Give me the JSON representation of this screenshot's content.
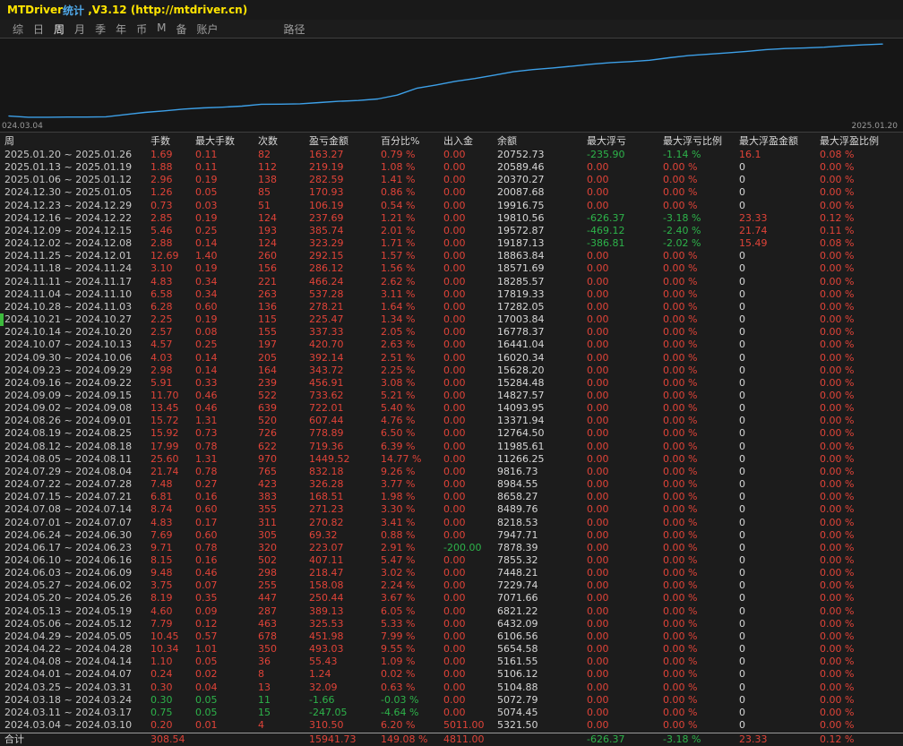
{
  "title_bar": {
    "app_name": "MTDriver",
    "app_suffix": "统计",
    "version": " ,V3.12 (http://mtdriver.cn)"
  },
  "menu": {
    "items": [
      "综",
      "日",
      "周",
      "月",
      "季",
      "年",
      "币",
      "M",
      "备",
      "账户"
    ],
    "selected": "周",
    "path_label": "路径"
  },
  "colors": {
    "accent_red": "#e04338",
    "accent_green": "#2db34a",
    "chart_line": "#3da0e8",
    "title_yellow": "#ffe400"
  },
  "chart_data": {
    "type": "line",
    "title": "",
    "xlabel": "",
    "ylabel": "余额",
    "x_start_label": "024.03.04",
    "x_end_label": "2025.01.20",
    "ylim": [
      5000,
      21000
    ],
    "legend": false,
    "grid": false,
    "x": [
      "2024.03.04",
      "2024.03.11",
      "2024.03.18",
      "2024.03.25",
      "2024.04.01",
      "2024.04.08",
      "2024.04.22",
      "2024.04.29",
      "2024.05.06",
      "2024.05.13",
      "2024.05.20",
      "2024.05.27",
      "2024.06.03",
      "2024.06.10",
      "2024.06.17",
      "2024.06.24",
      "2024.07.01",
      "2024.07.08",
      "2024.07.15",
      "2024.07.22",
      "2024.07.29",
      "2024.08.05",
      "2024.08.12",
      "2024.08.19",
      "2024.08.26",
      "2024.09.02",
      "2024.09.09",
      "2024.09.16",
      "2024.09.23",
      "2024.09.30",
      "2024.10.07",
      "2024.10.14",
      "2024.10.21",
      "2024.10.28",
      "2024.11.04",
      "2024.11.11",
      "2024.11.18",
      "2024.11.25",
      "2024.12.02",
      "2024.12.09",
      "2024.12.16",
      "2024.12.23",
      "2024.12.30",
      "2025.01.06",
      "2025.01.13",
      "2025.01.20"
    ],
    "series": [
      {
        "name": "余额",
        "values": [
          5321.5,
          5074.45,
          5072.79,
          5104.88,
          5106.12,
          5161.55,
          5654.58,
          6106.56,
          6432.09,
          6821.22,
          7071.66,
          7229.74,
          7448.21,
          7855.32,
          7878.39,
          7947.71,
          8218.53,
          8489.76,
          8658.27,
          8984.55,
          9816.73,
          11266.25,
          11985.61,
          12764.5,
          13371.94,
          14093.95,
          14827.57,
          15284.48,
          15628.2,
          16020.34,
          16441.04,
          16778.37,
          17003.84,
          17282.05,
          17819.33,
          18285.57,
          18571.69,
          18863.84,
          19187.13,
          19572.87,
          19810.56,
          19916.75,
          20087.68,
          20370.27,
          20589.46,
          20752.73
        ]
      }
    ]
  },
  "table": {
    "headers": [
      "周",
      "手数",
      "最大手数",
      "次数",
      "盈亏金额",
      "百分比%",
      "出入金",
      "余额",
      "最大浮亏",
      "最大浮亏比例",
      "最大浮盈金额",
      "最大浮盈比例"
    ],
    "rows": [
      [
        "2025.01.20 ~ 2025.01.26",
        "1.69",
        "0.11",
        "82",
        "163.27",
        "0.79 %",
        "0.00",
        "20752.73",
        "-235.90",
        "-1.14 %",
        "16.1",
        "0.08 %"
      ],
      [
        "2025.01.13 ~ 2025.01.19",
        "1.88",
        "0.11",
        "112",
        "219.19",
        "1.08 %",
        "0.00",
        "20589.46",
        "0.00",
        "0.00 %",
        "0",
        "0.00 %"
      ],
      [
        "2025.01.06 ~ 2025.01.12",
        "2.96",
        "0.19",
        "138",
        "282.59",
        "1.41 %",
        "0.00",
        "20370.27",
        "0.00",
        "0.00 %",
        "0",
        "0.00 %"
      ],
      [
        "2024.12.30 ~ 2025.01.05",
        "1.26",
        "0.05",
        "85",
        "170.93",
        "0.86 %",
        "0.00",
        "20087.68",
        "0.00",
        "0.00 %",
        "0",
        "0.00 %"
      ],
      [
        "2024.12.23 ~ 2024.12.29",
        "0.73",
        "0.03",
        "51",
        "106.19",
        "0.54 %",
        "0.00",
        "19916.75",
        "0.00",
        "0.00 %",
        "0",
        "0.00 %"
      ],
      [
        "2024.12.16 ~ 2024.12.22",
        "2.85",
        "0.19",
        "124",
        "237.69",
        "1.21 %",
        "0.00",
        "19810.56",
        "-626.37",
        "-3.18 %",
        "23.33",
        "0.12 %"
      ],
      [
        "2024.12.09 ~ 2024.12.15",
        "5.46",
        "0.25",
        "193",
        "385.74",
        "2.01 %",
        "0.00",
        "19572.87",
        "-469.12",
        "-2.40 %",
        "21.74",
        "0.11 %"
      ],
      [
        "2024.12.02 ~ 2024.12.08",
        "2.88",
        "0.14",
        "124",
        "323.29",
        "1.71 %",
        "0.00",
        "19187.13",
        "-386.81",
        "-2.02 %",
        "15.49",
        "0.08 %"
      ],
      [
        "2024.11.25 ~ 2024.12.01",
        "12.69",
        "1.40",
        "260",
        "292.15",
        "1.57 %",
        "0.00",
        "18863.84",
        "0.00",
        "0.00 %",
        "0",
        "0.00 %"
      ],
      [
        "2024.11.18 ~ 2024.11.24",
        "3.10",
        "0.19",
        "156",
        "286.12",
        "1.56 %",
        "0.00",
        "18571.69",
        "0.00",
        "0.00 %",
        "0",
        "0.00 %"
      ],
      [
        "2024.11.11 ~ 2024.11.17",
        "4.83",
        "0.34",
        "221",
        "466.24",
        "2.62 %",
        "0.00",
        "18285.57",
        "0.00",
        "0.00 %",
        "0",
        "0.00 %"
      ],
      [
        "2024.11.04 ~ 2024.11.10",
        "6.58",
        "0.34",
        "263",
        "537.28",
        "3.11 %",
        "0.00",
        "17819.33",
        "0.00",
        "0.00 %",
        "0",
        "0.00 %"
      ],
      [
        "2024.10.28 ~ 2024.11.03",
        "6.28",
        "0.60",
        "136",
        "278.21",
        "1.64 %",
        "0.00",
        "17282.05",
        "0.00",
        "0.00 %",
        "0",
        "0.00 %"
      ],
      [
        "2024.10.21 ~ 2024.10.27",
        "2.25",
        "0.19",
        "115",
        "225.47",
        "1.34 %",
        "0.00",
        "17003.84",
        "0.00",
        "0.00 %",
        "0",
        "0.00 %"
      ],
      [
        "2024.10.14 ~ 2024.10.20",
        "2.57",
        "0.08",
        "155",
        "337.33",
        "2.05 %",
        "0.00",
        "16778.37",
        "0.00",
        "0.00 %",
        "0",
        "0.00 %"
      ],
      [
        "2024.10.07 ~ 2024.10.13",
        "4.57",
        "0.25",
        "197",
        "420.70",
        "2.63 %",
        "0.00",
        "16441.04",
        "0.00",
        "0.00 %",
        "0",
        "0.00 %"
      ],
      [
        "2024.09.30 ~ 2024.10.06",
        "4.03",
        "0.14",
        "205",
        "392.14",
        "2.51 %",
        "0.00",
        "16020.34",
        "0.00",
        "0.00 %",
        "0",
        "0.00 %"
      ],
      [
        "2024.09.23 ~ 2024.09.29",
        "2.98",
        "0.14",
        "164",
        "343.72",
        "2.25 %",
        "0.00",
        "15628.20",
        "0.00",
        "0.00 %",
        "0",
        "0.00 %"
      ],
      [
        "2024.09.16 ~ 2024.09.22",
        "5.91",
        "0.33",
        "239",
        "456.91",
        "3.08 %",
        "0.00",
        "15284.48",
        "0.00",
        "0.00 %",
        "0",
        "0.00 %"
      ],
      [
        "2024.09.09 ~ 2024.09.15",
        "11.70",
        "0.46",
        "522",
        "733.62",
        "5.21 %",
        "0.00",
        "14827.57",
        "0.00",
        "0.00 %",
        "0",
        "0.00 %"
      ],
      [
        "2024.09.02 ~ 2024.09.08",
        "13.45",
        "0.46",
        "639",
        "722.01",
        "5.40 %",
        "0.00",
        "14093.95",
        "0.00",
        "0.00 %",
        "0",
        "0.00 %"
      ],
      [
        "2024.08.26 ~ 2024.09.01",
        "15.72",
        "1.31",
        "520",
        "607.44",
        "4.76 %",
        "0.00",
        "13371.94",
        "0.00",
        "0.00 %",
        "0",
        "0.00 %"
      ],
      [
        "2024.08.19 ~ 2024.08.25",
        "15.92",
        "0.73",
        "726",
        "778.89",
        "6.50 %",
        "0.00",
        "12764.50",
        "0.00",
        "0.00 %",
        "0",
        "0.00 %"
      ],
      [
        "2024.08.12 ~ 2024.08.18",
        "17.99",
        "0.78",
        "622",
        "719.36",
        "6.39 %",
        "0.00",
        "11985.61",
        "0.00",
        "0.00 %",
        "0",
        "0.00 %"
      ],
      [
        "2024.08.05 ~ 2024.08.11",
        "25.60",
        "1.31",
        "970",
        "1449.52",
        "14.77 %",
        "0.00",
        "11266.25",
        "0.00",
        "0.00 %",
        "0",
        "0.00 %"
      ],
      [
        "2024.07.29 ~ 2024.08.04",
        "21.74",
        "0.78",
        "765",
        "832.18",
        "9.26 %",
        "0.00",
        "9816.73",
        "0.00",
        "0.00 %",
        "0",
        "0.00 %"
      ],
      [
        "2024.07.22 ~ 2024.07.28",
        "7.48",
        "0.27",
        "423",
        "326.28",
        "3.77 %",
        "0.00",
        "8984.55",
        "0.00",
        "0.00 %",
        "0",
        "0.00 %"
      ],
      [
        "2024.07.15 ~ 2024.07.21",
        "6.81",
        "0.16",
        "383",
        "168.51",
        "1.98 %",
        "0.00",
        "8658.27",
        "0.00",
        "0.00 %",
        "0",
        "0.00 %"
      ],
      [
        "2024.07.08 ~ 2024.07.14",
        "8.74",
        "0.60",
        "355",
        "271.23",
        "3.30 %",
        "0.00",
        "8489.76",
        "0.00",
        "0.00 %",
        "0",
        "0.00 %"
      ],
      [
        "2024.07.01 ~ 2024.07.07",
        "4.83",
        "0.17",
        "311",
        "270.82",
        "3.41 %",
        "0.00",
        "8218.53",
        "0.00",
        "0.00 %",
        "0",
        "0.00 %"
      ],
      [
        "2024.06.24 ~ 2024.06.30",
        "7.69",
        "0.60",
        "305",
        "69.32",
        "0.88 %",
        "0.00",
        "7947.71",
        "0.00",
        "0.00 %",
        "0",
        "0.00 %"
      ],
      [
        "2024.06.17 ~ 2024.06.23",
        "9.71",
        "0.78",
        "320",
        "223.07",
        "2.91 %",
        "-200.00",
        "7878.39",
        "0.00",
        "0.00 %",
        "0",
        "0.00 %"
      ],
      [
        "2024.06.10 ~ 2024.06.16",
        "8.15",
        "0.16",
        "502",
        "407.11",
        "5.47 %",
        "0.00",
        "7855.32",
        "0.00",
        "0.00 %",
        "0",
        "0.00 %"
      ],
      [
        "2024.06.03 ~ 2024.06.09",
        "9.48",
        "0.46",
        "298",
        "218.47",
        "3.02 %",
        "0.00",
        "7448.21",
        "0.00",
        "0.00 %",
        "0",
        "0.00 %"
      ],
      [
        "2024.05.27 ~ 2024.06.02",
        "3.75",
        "0.07",
        "255",
        "158.08",
        "2.24 %",
        "0.00",
        "7229.74",
        "0.00",
        "0.00 %",
        "0",
        "0.00 %"
      ],
      [
        "2024.05.20 ~ 2024.05.26",
        "8.19",
        "0.35",
        "447",
        "250.44",
        "3.67 %",
        "0.00",
        "7071.66",
        "0.00",
        "0.00 %",
        "0",
        "0.00 %"
      ],
      [
        "2024.05.13 ~ 2024.05.19",
        "4.60",
        "0.09",
        "287",
        "389.13",
        "6.05 %",
        "0.00",
        "6821.22",
        "0.00",
        "0.00 %",
        "0",
        "0.00 %"
      ],
      [
        "2024.05.06 ~ 2024.05.12",
        "7.79",
        "0.12",
        "463",
        "325.53",
        "5.33 %",
        "0.00",
        "6432.09",
        "0.00",
        "0.00 %",
        "0",
        "0.00 %"
      ],
      [
        "2024.04.29 ~ 2024.05.05",
        "10.45",
        "0.57",
        "678",
        "451.98",
        "7.99 %",
        "0.00",
        "6106.56",
        "0.00",
        "0.00 %",
        "0",
        "0.00 %"
      ],
      [
        "2024.04.22 ~ 2024.04.28",
        "10.34",
        "1.01",
        "350",
        "493.03",
        "9.55 %",
        "0.00",
        "5654.58",
        "0.00",
        "0.00 %",
        "0",
        "0.00 %"
      ],
      [
        "2024.04.08 ~ 2024.04.14",
        "1.10",
        "0.05",
        "36",
        "55.43",
        "1.09 %",
        "0.00",
        "5161.55",
        "0.00",
        "0.00 %",
        "0",
        "0.00 %"
      ],
      [
        "2024.04.01 ~ 2024.04.07",
        "0.24",
        "0.02",
        "8",
        "1.24",
        "0.02 %",
        "0.00",
        "5106.12",
        "0.00",
        "0.00 %",
        "0",
        "0.00 %"
      ],
      [
        "2024.03.25 ~ 2024.03.31",
        "0.30",
        "0.04",
        "13",
        "32.09",
        "0.63 %",
        "0.00",
        "5104.88",
        "0.00",
        "0.00 %",
        "0",
        "0.00 %"
      ],
      [
        "2024.03.18 ~ 2024.03.24",
        "0.30",
        "0.05",
        "11",
        "-1.66",
        "-0.03 %",
        "0.00",
        "5072.79",
        "0.00",
        "0.00 %",
        "0",
        "0.00 %"
      ],
      [
        "2024.03.11 ~ 2024.03.17",
        "0.75",
        "0.05",
        "15",
        "-247.05",
        "-4.64 %",
        "0.00",
        "5074.45",
        "0.00",
        "0.00 %",
        "0",
        "0.00 %"
      ],
      [
        "2024.03.04 ~ 2024.03.10",
        "0.20",
        "0.01",
        "4",
        "310.50",
        "6.20 %",
        "5011.00",
        "5321.50",
        "0.00",
        "0.00 %",
        "0",
        "0.00 %"
      ]
    ],
    "footer": [
      "合计",
      "308.54",
      "",
      "",
      "15941.73",
      "149.08 %",
      "4811.00",
      "",
      "-626.37",
      "-3.18 %",
      "23.33",
      "0.12 %"
    ]
  }
}
